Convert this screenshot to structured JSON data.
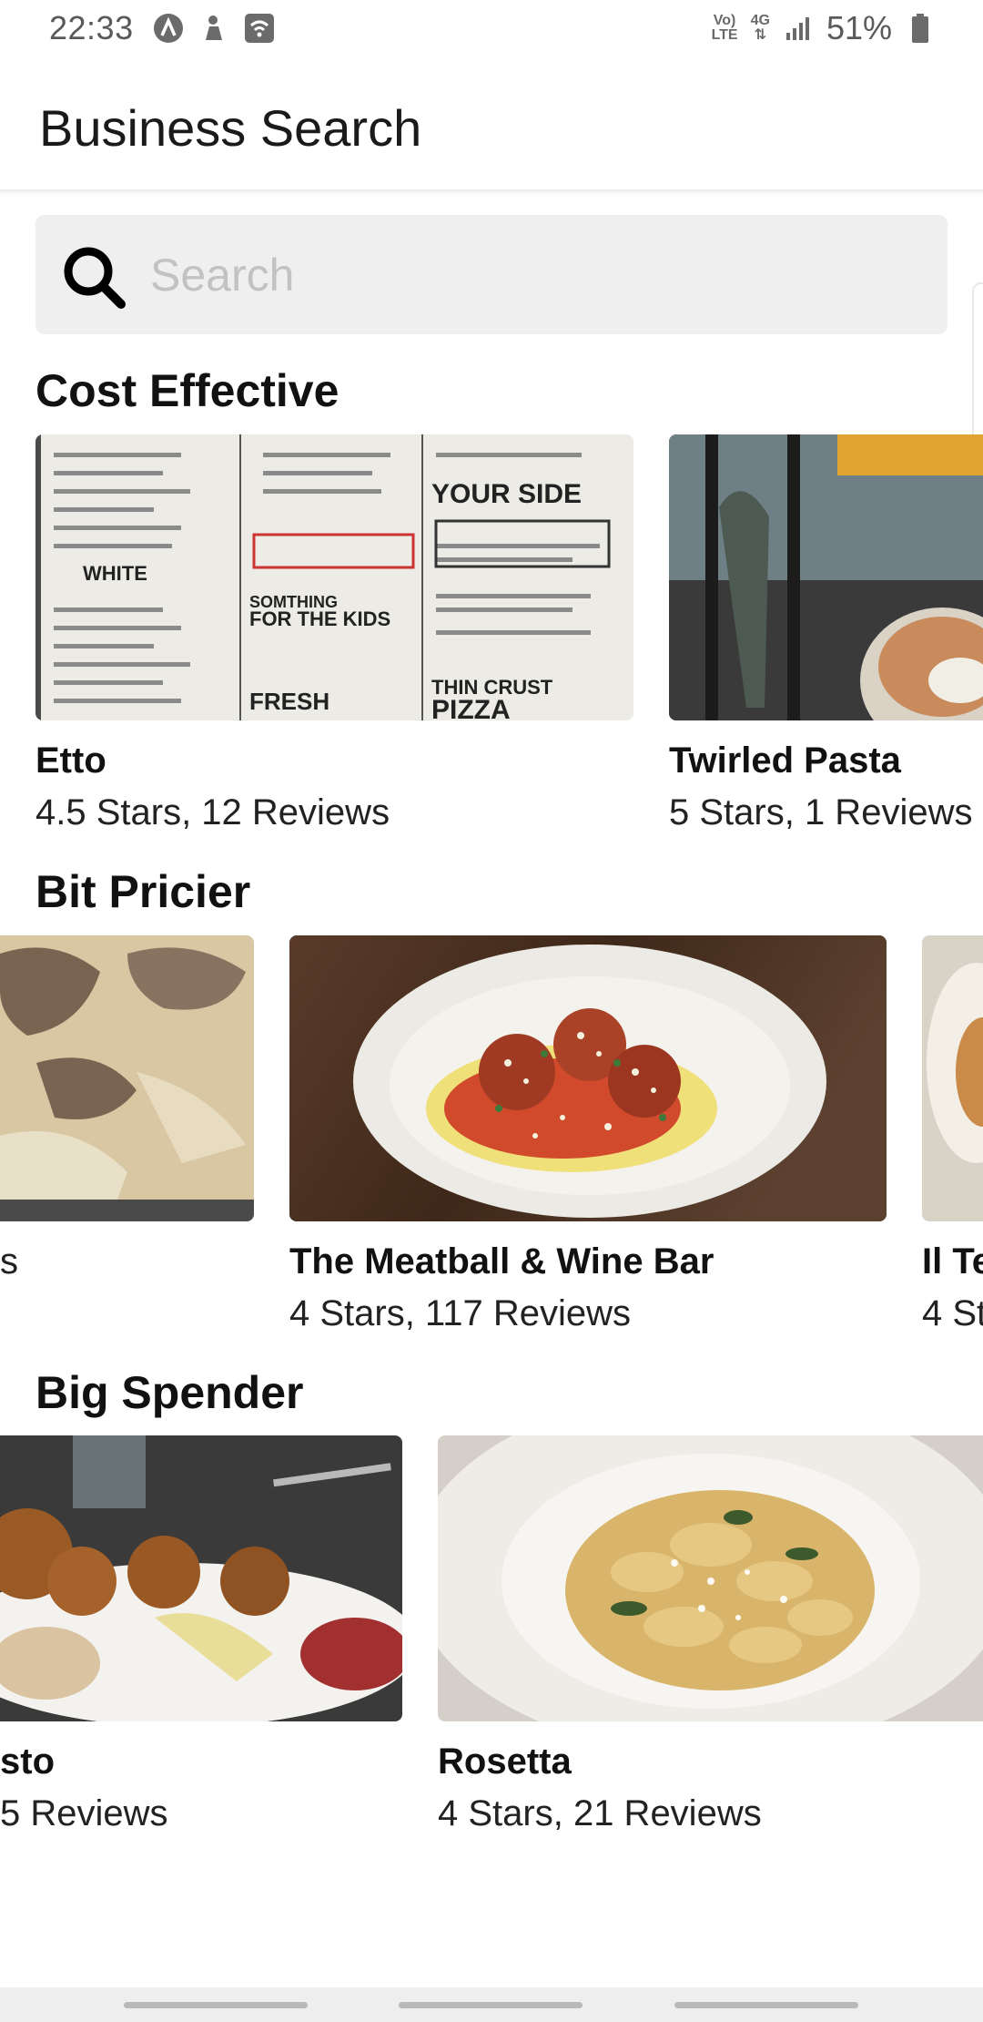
{
  "status_bar": {
    "time": "22:33",
    "network_top": "Vo)",
    "network_bottom": "LTE",
    "signal_type": "4G",
    "battery": "51%"
  },
  "app_bar": {
    "title": "Business Search"
  },
  "search": {
    "placeholder": "Search",
    "value": ""
  },
  "sections": [
    {
      "title": "Cost Effective",
      "cards": [
        {
          "name": "Etto",
          "subtitle": "4.5 Stars, 12 Reviews",
          "image": "menu-photo"
        },
        {
          "name": "Twirled Pasta",
          "subtitle": "5 Stars, 1 Reviews",
          "image": "storefront-photo"
        }
      ]
    },
    {
      "title": "Bit Pricier",
      "cards": [
        {
          "name": "",
          "subtitle": "s",
          "image": "truffle-pasta-photo"
        },
        {
          "name": "The Meatball & Wine Bar",
          "subtitle": "4 Stars, 117 Reviews",
          "image": "meatball-photo"
        },
        {
          "name": "Il Te",
          "subtitle": "4 St",
          "image": "dish-photo"
        }
      ]
    },
    {
      "title": "Big Spender",
      "cards": [
        {
          "name": "sto",
          "subtitle": "5 Reviews",
          "image": "platter-photo"
        },
        {
          "name": "Rosetta",
          "subtitle": "4 Stars, 21 Reviews",
          "image": "tortellini-photo"
        }
      ]
    }
  ],
  "colors": {
    "background": "#ffffff",
    "search_bg": "#efefef",
    "placeholder": "#c2c2c2",
    "nav_bar": "#eeeeee"
  }
}
